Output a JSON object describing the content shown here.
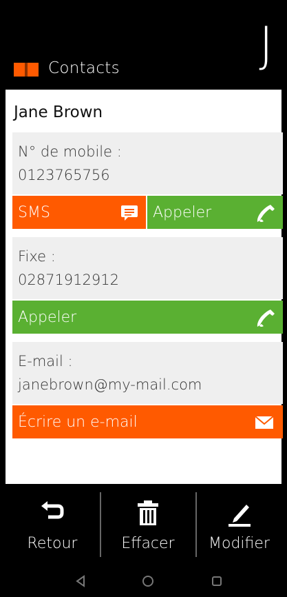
{
  "header": {
    "title": "Contacts",
    "initial": "J",
    "icon": "book-icon"
  },
  "contact": {
    "name": "Jane Brown"
  },
  "mobile": {
    "label": "N° de mobile :",
    "value": "0123765756",
    "sms_label": "SMS",
    "call_label": "Appeler"
  },
  "landline": {
    "label": "Fixe :",
    "value": "02871912912",
    "call_label": "Appeler"
  },
  "email": {
    "label": "E-mail :",
    "value": "janebrown@my-mail.com",
    "write_label": "Écrire un e-mail"
  },
  "bottom": {
    "back_label": "Retour",
    "delete_label": "Effacer",
    "edit_label": "Modifier"
  },
  "colors": {
    "orange": "#ff5a00",
    "green": "#5ab032",
    "block_bg": "#efefef"
  }
}
